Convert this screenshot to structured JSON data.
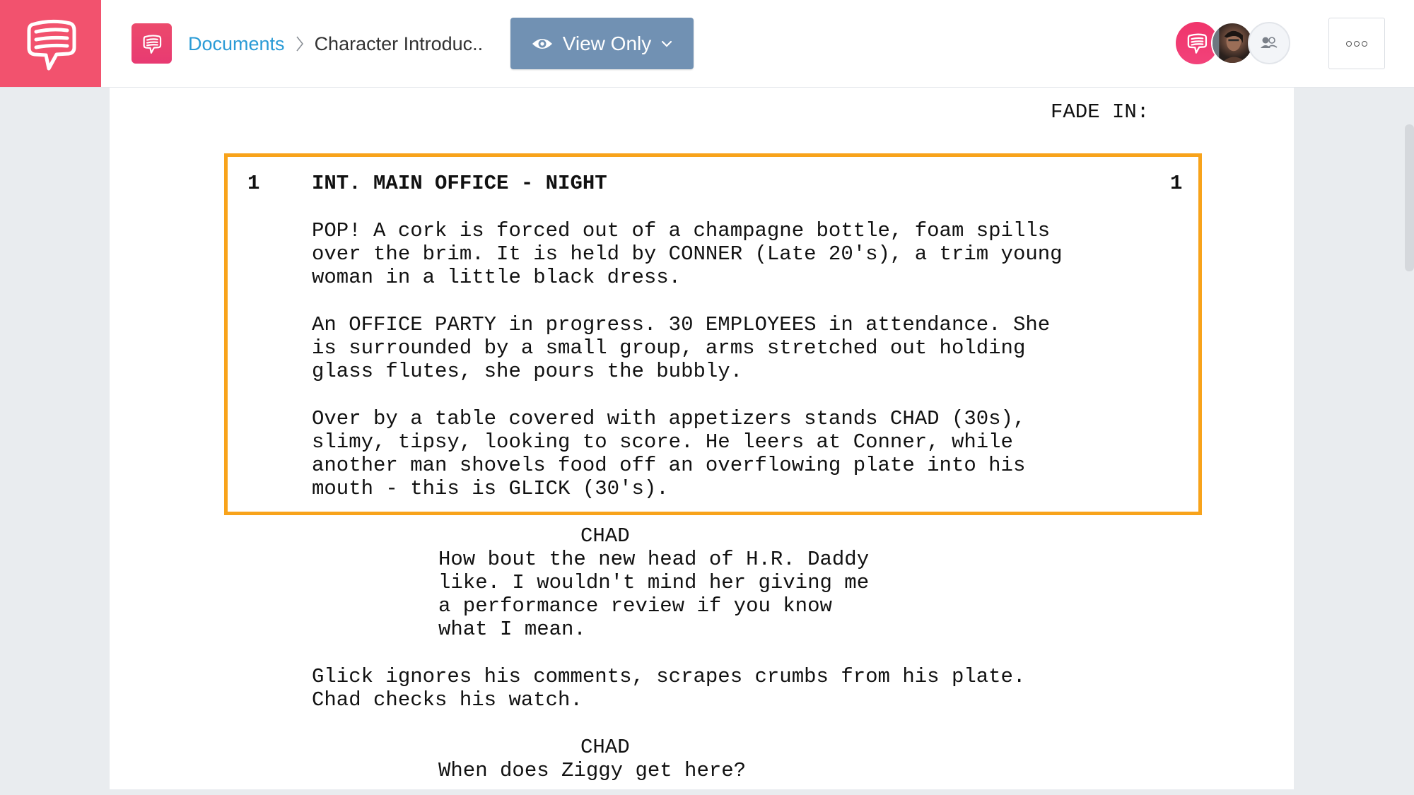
{
  "header": {
    "app_logo": "chat-bubble-logo",
    "breadcrumb": {
      "root": "Documents",
      "separator": "chevron-right-icon",
      "current": "Character Introduc.."
    },
    "view_mode_button": {
      "icon": "eye-icon",
      "label": "View Only",
      "dropdown_icon": "chevron-down-icon"
    },
    "collaborators": [
      {
        "type": "app-avatar",
        "icon": "chat-bubble-icon"
      },
      {
        "type": "user-avatar",
        "icon": "user-photo"
      },
      {
        "type": "share-button",
        "icon": "users-icon"
      }
    ],
    "more_button_icon": "more-dots-icon"
  },
  "colors": {
    "brand_pink": "#F2526E",
    "link_blue": "#2A9BD6",
    "view_only_bg": "#7191B3",
    "highlight_border": "#F8A31B",
    "background": "#E9ECEF"
  },
  "script": {
    "transition": "FADE IN:",
    "scene": {
      "number_left": "1",
      "number_right": "1",
      "heading": "INT. MAIN OFFICE - NIGHT",
      "action_blocks": [
        [
          "POP! A cork is forced out of a champagne bottle, foam spills",
          "over the brim. It is held by CONNER (Late 20's), a trim young",
          "woman in a little black dress."
        ],
        [
          "An OFFICE PARTY in progress. 30 EMPLOYEES in attendance. She",
          "is surrounded by a small group, arms stretched out holding",
          "glass flutes, she pours the bubbly."
        ],
        [
          "Over by a table covered with appetizers stands CHAD (30s),",
          "slimy, tipsy, looking to score. He leers at Conner, while",
          "another man shovels food off an overflowing plate into his",
          "mouth - this is GLICK (30's)."
        ]
      ]
    },
    "dialogue_1": {
      "character": "CHAD",
      "lines": [
        "How bout the new head of H.R. Daddy",
        "like. I wouldn't mind her giving me",
        "a performance review if you know",
        "what I mean."
      ]
    },
    "action_after": [
      "Glick ignores his comments, scrapes crumbs from his plate.",
      "Chad checks his watch."
    ],
    "dialogue_2": {
      "character": "CHAD",
      "lines": [
        "When does Ziggy get here?"
      ]
    }
  }
}
